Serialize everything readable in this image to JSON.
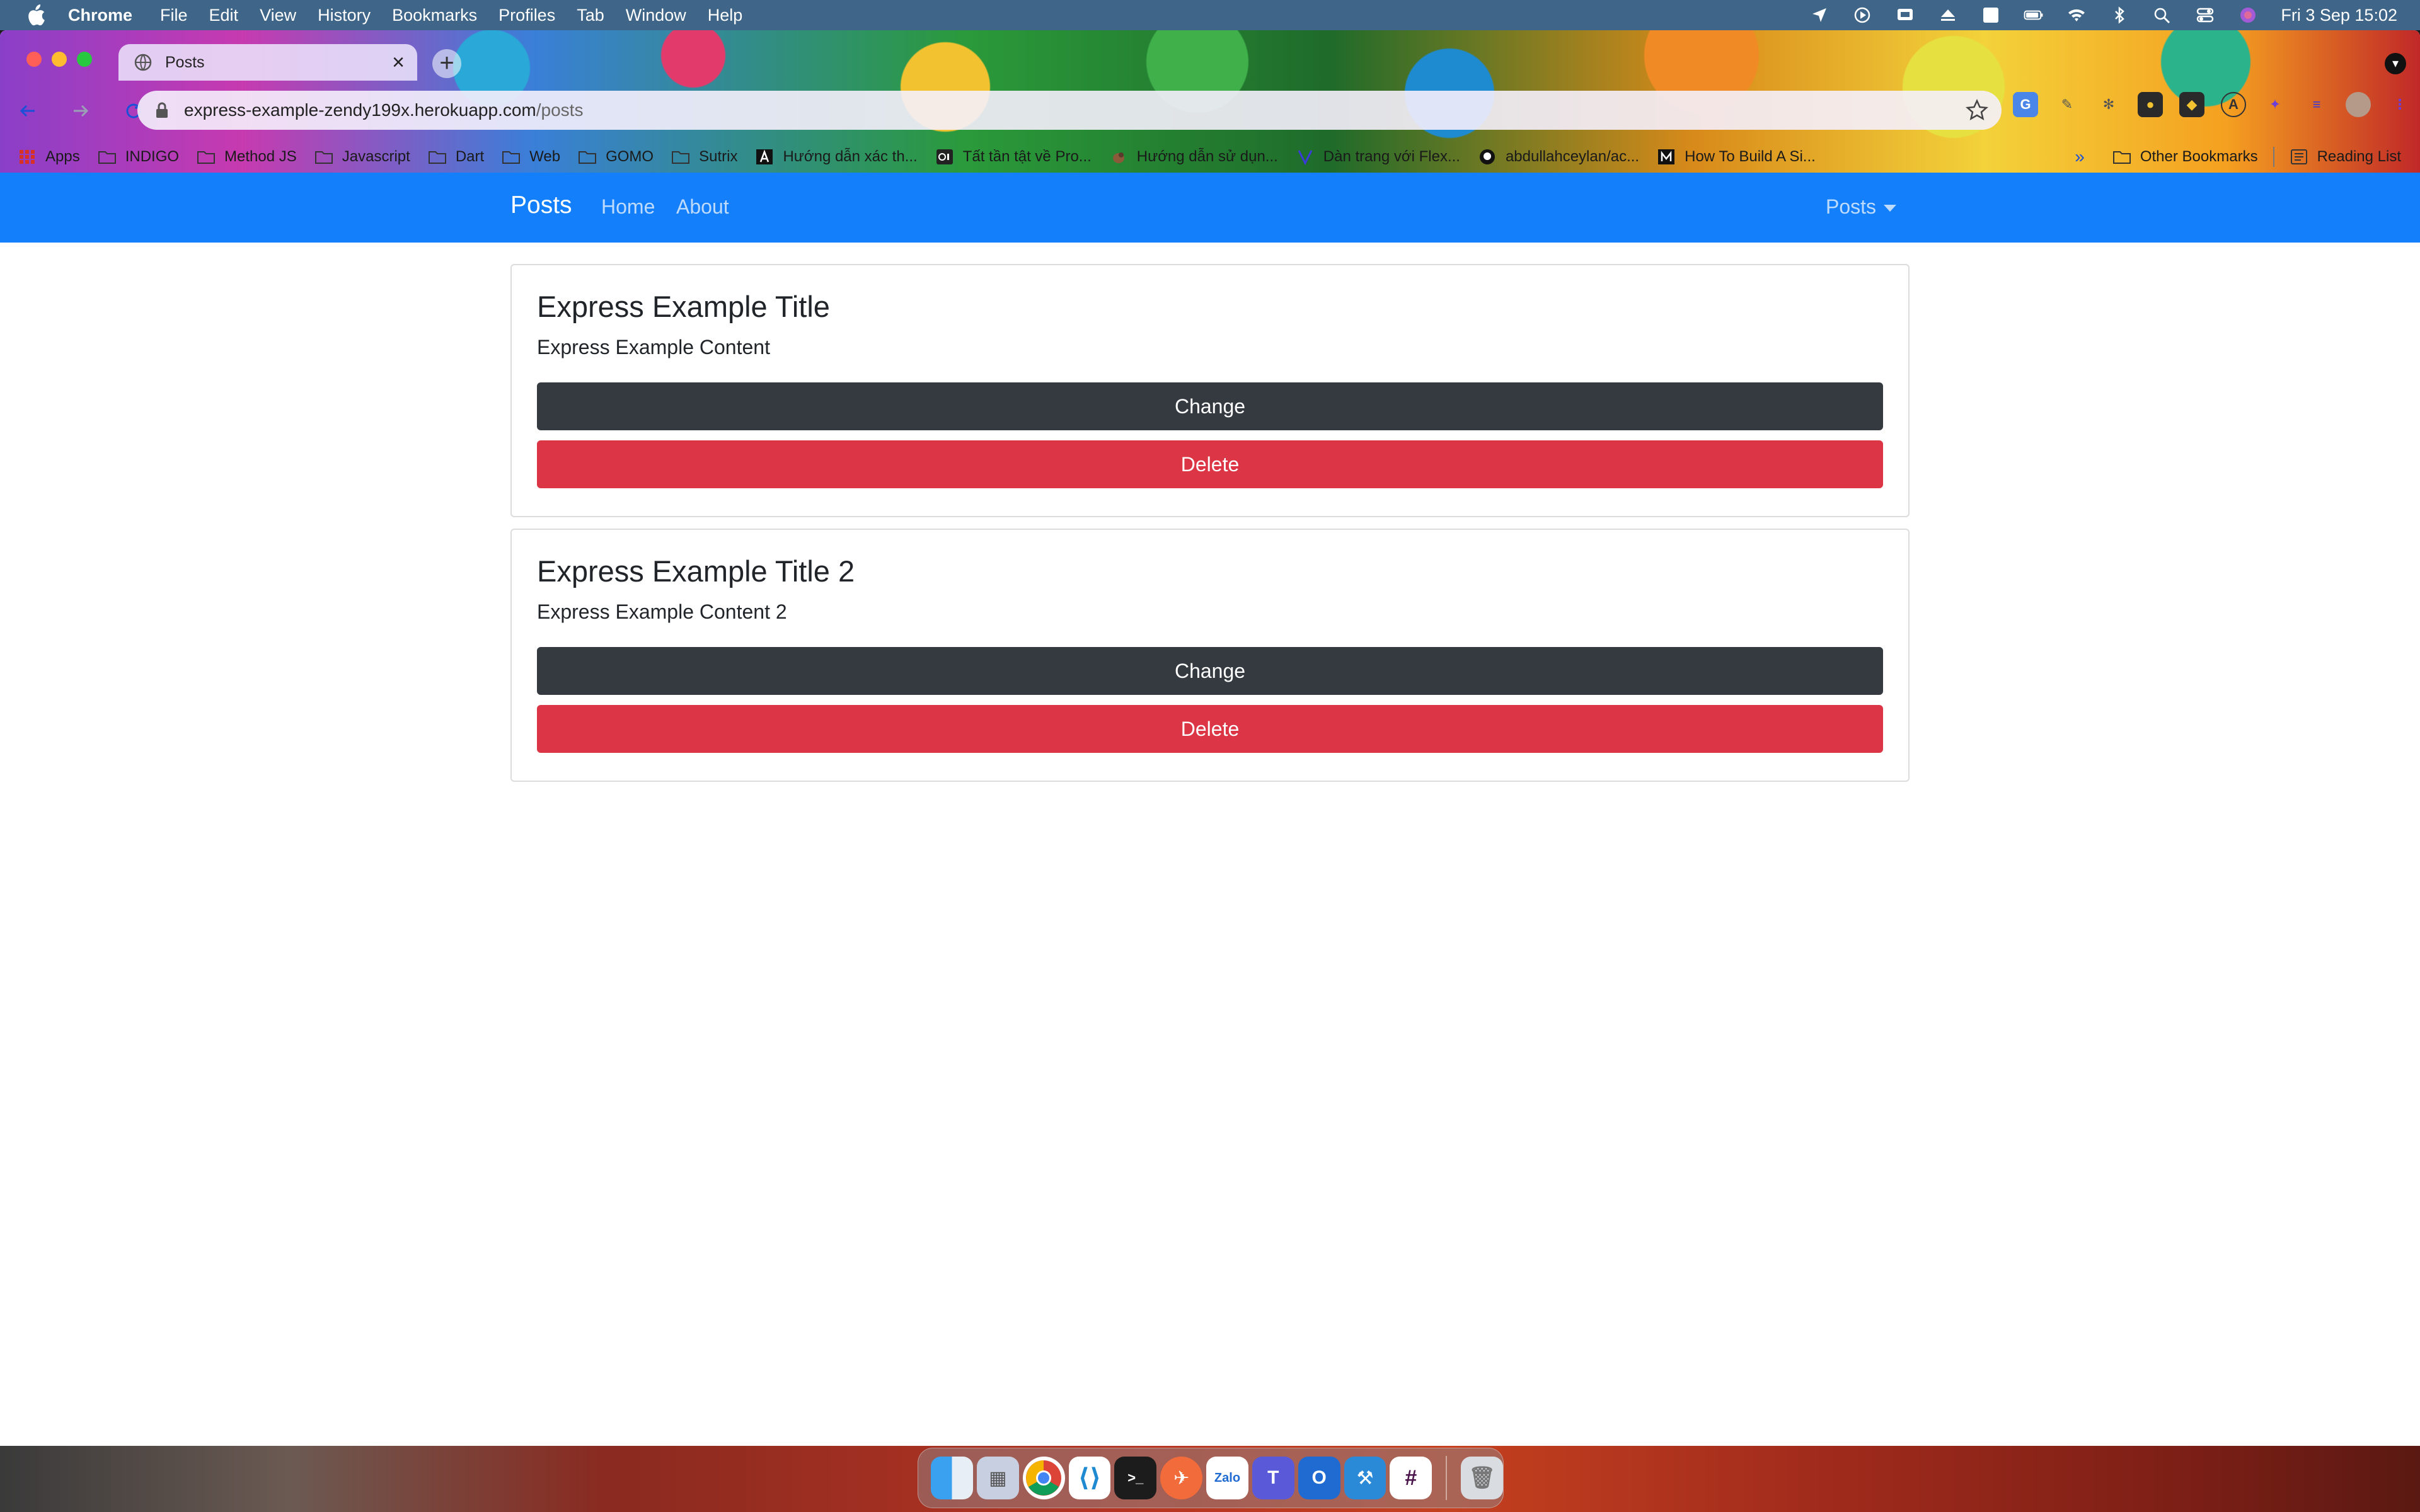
{
  "menubar": {
    "app_name": "Chrome",
    "items": [
      "File",
      "Edit",
      "View",
      "History",
      "Bookmarks",
      "Profiles",
      "Tab",
      "Window",
      "Help"
    ],
    "clock": "Fri 3 Sep  15:02",
    "status_icons": [
      "location-icon",
      "play-icon",
      "cast-icon",
      "eject-icon",
      "input-source-icon",
      "battery-icon",
      "wifi-icon",
      "bluetooth-icon",
      "spotlight-icon",
      "control-center-icon",
      "siri-icon"
    ],
    "input_source_letter": "A"
  },
  "browser": {
    "tab_title": "Posts",
    "url_host": "express-example-zendy199x.herokuapp.com",
    "url_path": "/posts",
    "bookmarks": [
      {
        "label": "Apps",
        "icon": "apps-grid-icon"
      },
      {
        "label": "INDIGO",
        "icon": "folder-icon"
      },
      {
        "label": "Method JS",
        "icon": "folder-icon"
      },
      {
        "label": "Javascript",
        "icon": "folder-icon"
      },
      {
        "label": "Dart",
        "icon": "folder-icon"
      },
      {
        "label": "Web",
        "icon": "folder-icon"
      },
      {
        "label": "GOMO",
        "icon": "folder-icon"
      },
      {
        "label": "Sutrix",
        "icon": "folder-icon"
      },
      {
        "label": "Hướng dẫn xác th...",
        "icon": "a-logo-icon"
      },
      {
        "label": "Tất tần tật về Pro...",
        "icon": "ai-logo-icon"
      },
      {
        "label": "Hướng dẫn sử dụn...",
        "icon": "bird-icon"
      },
      {
        "label": "Dàn trang với Flex...",
        "icon": "v-logo-icon"
      },
      {
        "label": "abdullahceylan/ac...",
        "icon": "github-icon"
      },
      {
        "label": "How To Build A Si...",
        "icon": "medium-icon"
      }
    ],
    "bookmarks_right": {
      "other": "Other Bookmarks",
      "reading_list": "Reading List"
    }
  },
  "page": {
    "brand": "Posts",
    "nav_links": [
      "Home",
      "About"
    ],
    "dropdown_label": "Posts",
    "posts": [
      {
        "title": "Express Example Title",
        "content": "Express Example Content",
        "change_label": "Change",
        "delete_label": "Delete"
      },
      {
        "title": "Express Example Title 2",
        "content": "Express Example Content 2",
        "change_label": "Change",
        "delete_label": "Delete"
      }
    ]
  },
  "dock": {
    "apps": [
      {
        "name": "finder-icon",
        "label": ""
      },
      {
        "name": "launchpad-icon",
        "label": ""
      },
      {
        "name": "chrome-icon",
        "label": ""
      },
      {
        "name": "vscode-icon",
        "label": ""
      },
      {
        "name": "terminal-icon",
        "label": ""
      },
      {
        "name": "postman-icon",
        "label": ""
      },
      {
        "name": "zalo-icon",
        "label": "Zalo"
      },
      {
        "name": "teams-icon",
        "label": ""
      },
      {
        "name": "outlook-icon",
        "label": ""
      },
      {
        "name": "xcode-icon",
        "label": ""
      },
      {
        "name": "slack-icon",
        "label": ""
      }
    ],
    "trash": "trash-icon"
  },
  "colors": {
    "navbar": "#147ffb",
    "btn_dark": "#343a40",
    "btn_danger": "#dc3545",
    "menubar": "#3f6688"
  }
}
